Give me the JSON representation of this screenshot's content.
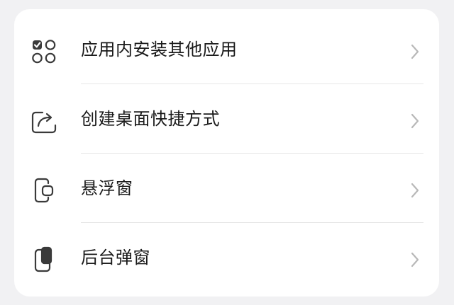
{
  "settings_list": {
    "items": [
      {
        "label": "应用内安装其他应用",
        "icon": "apps-grid-icon"
      },
      {
        "label": "创建桌面快捷方式",
        "icon": "share-shortcut-icon"
      },
      {
        "label": "悬浮窗",
        "icon": "floating-window-icon"
      },
      {
        "label": "后台弹窗",
        "icon": "background-popup-icon"
      }
    ]
  },
  "colors": {
    "background": "#f1f1f3",
    "card": "#ffffff",
    "text": "#1a1a1a",
    "icon": "#3a3a3a",
    "chevron": "#b8b8b8",
    "divider": "#e6e6e6"
  }
}
